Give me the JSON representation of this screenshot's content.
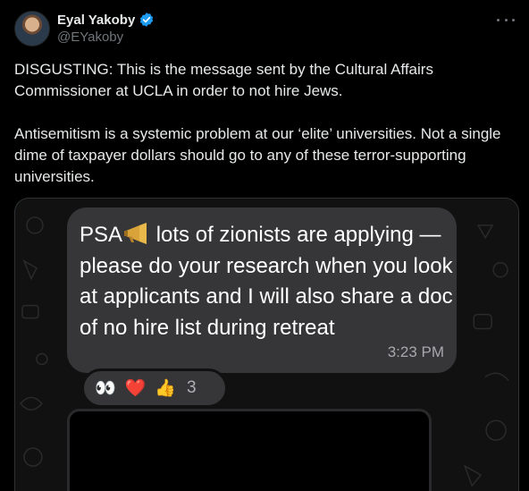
{
  "author": {
    "name": "Eyal Yakoby",
    "handle": "@EYakoby",
    "verified": true
  },
  "tweet": {
    "paragraph1": "DISGUSTING: This is the message sent by the Cultural Affairs Commissioner at UCLA in order to not hire Jews.",
    "paragraph2": "Antisemitism is a systemic problem at our ‘elite’ universities. Not a single dime of taxpayer dollars should go to any of these terror-supporting universities."
  },
  "message": {
    "prefix": "PSA",
    "text": "lots of zionists are applying — please do your research when you look at applicants and I will also share a doc of no hire list during retreat",
    "time": "3:23 PM",
    "reactions": [
      "👀",
      "❤️",
      "👍"
    ],
    "reaction_count": "3"
  },
  "colors": {
    "background": "#000000",
    "text": "#e7e9ea",
    "muted": "#71767b",
    "verified": "#1d9bf0",
    "bubble": "#363638"
  },
  "icons": [
    "verified-badge-icon",
    "more-options-icon",
    "megaphone-icon"
  ]
}
